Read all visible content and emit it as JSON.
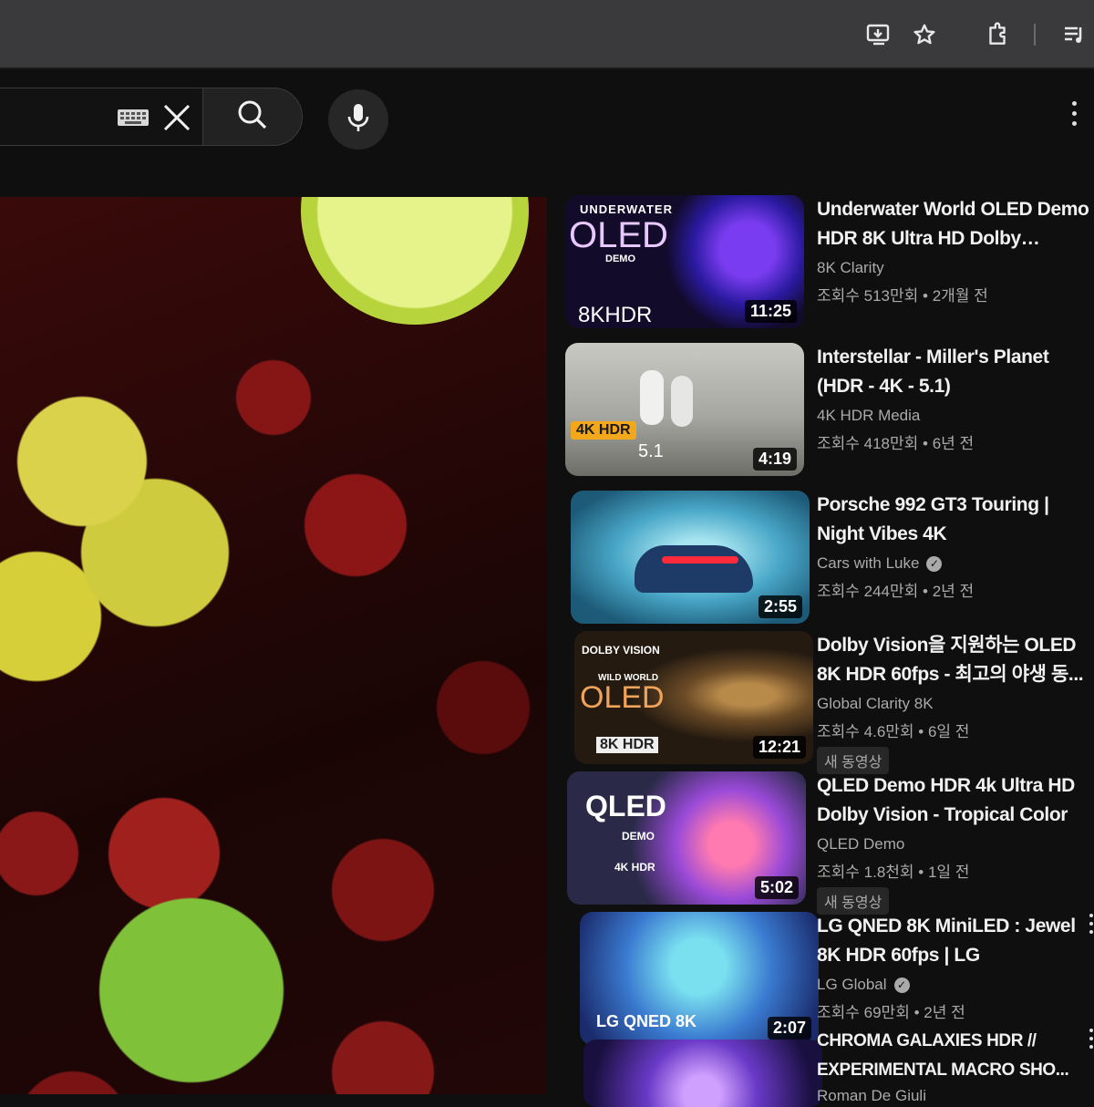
{
  "browser": {
    "icons": [
      "install-app-icon",
      "bookmark-star-icon",
      "extensions-icon",
      "reading-list-icon"
    ]
  },
  "header": {
    "search_value": "",
    "icons": [
      "keyboard-icon",
      "clear-icon",
      "search-icon",
      "mic-icon",
      "more-options-icon"
    ]
  },
  "recommendations": [
    {
      "title": "Underwater World OLED Demo HDR 8K Ultra HD Dolby Vision...",
      "channel": "8K Clarity",
      "verified": false,
      "views": "조회수 513만회",
      "age": "2개월 전",
      "duration": "11:25",
      "badge": "",
      "thumb": {
        "line1": "UNDERWATER",
        "line2": "OLED",
        "line3": "DEMO",
        "line4": "8KHDR"
      }
    },
    {
      "title": "Interstellar - Miller's Planet (HDR - 4K - 5.1)",
      "channel": "4K HDR Media",
      "verified": false,
      "views": "조회수 418만회",
      "age": "6년 전",
      "duration": "4:19",
      "badge": "",
      "thumb": {
        "line1": "4K HDR",
        "line2": "5.1"
      }
    },
    {
      "title": "Porsche 992 GT3 Touring | Night Vibes 4K",
      "channel": "Cars with Luke",
      "verified": true,
      "views": "조회수 244만회",
      "age": "2년 전",
      "duration": "2:55",
      "badge": "",
      "thumb": {}
    },
    {
      "title": "Dolby Vision을 지원하는 OLED 8K HDR 60fps - 최고의 야생 동...",
      "channel": "Global Clarity 8K",
      "verified": false,
      "views": "조회수 4.6만회",
      "age": "6일 전",
      "duration": "12:21",
      "badge": "새 동영상",
      "thumb": {
        "line1": "DOLBY VISION",
        "line2": "WILD WORLD",
        "line3": "OLED",
        "line4": "8K HDR"
      }
    },
    {
      "title": "QLED Demo HDR 4k Ultra HD Dolby Vision - Tropical Color",
      "channel": "QLED Demo",
      "verified": false,
      "views": "조회수 1.8천회",
      "age": "1일 전",
      "duration": "5:02",
      "badge": "새 동영상",
      "thumb": {
        "line1": "QLED",
        "line2": "DEMO",
        "line3": "4K HDR"
      }
    },
    {
      "title": "LG QNED 8K MiniLED : Jewel 8K HDR 60fps | LG",
      "channel": "LG Global",
      "verified": true,
      "views": "조회수 69만회",
      "age": "2년 전",
      "duration": "2:07",
      "badge": "",
      "thumb": {
        "line1": "LG QNED 8K"
      }
    },
    {
      "title": "CHROMA GALAXIES HDR // EXPERIMENTAL MACRO SHO...",
      "channel": "Roman De Giuli",
      "verified": false,
      "views": "",
      "age": "",
      "duration": "",
      "badge": "",
      "thumb": {}
    }
  ]
}
